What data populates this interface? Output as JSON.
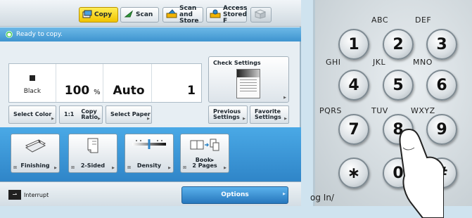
{
  "header": {
    "tabs": [
      {
        "label": "Copy",
        "icon": "copy-icon",
        "active": true
      },
      {
        "label": "Scan",
        "icon": "scan-icon",
        "active": false
      },
      {
        "label": "Scan and\nStore",
        "icon": "scan-store-icon",
        "active": false
      },
      {
        "label": "Access\nStored F",
        "icon": "access-stored-icon",
        "active": false
      }
    ]
  },
  "status": {
    "message": "Ready to copy."
  },
  "settings": {
    "color_mode": "Black",
    "ratio_value": "100",
    "ratio_unit": "%",
    "paper": "Auto",
    "copies": "1"
  },
  "select_buttons": {
    "select_color": "Select Color",
    "ratio_prefix": "1:1",
    "copy_ratio": "Copy\nRatio",
    "select_paper": "Select Paper",
    "previous_settings": "Previous\nSettings",
    "favorite_settings": "Favorite\nSettings"
  },
  "check_settings": {
    "label": "Check Settings"
  },
  "functions": [
    {
      "label": "Finishing",
      "icon": "finishing-icon"
    },
    {
      "label": "2-Sided",
      "icon": "two-sided-icon"
    },
    {
      "label": "Density",
      "icon": "density-icon"
    },
    {
      "label": "Book▸\n2 Pages",
      "icon": "book-to-pages-icon"
    }
  ],
  "bottom": {
    "interrupt": "Interrupt",
    "options": "Options"
  },
  "keypad": {
    "letters": {
      "k2": "ABC",
      "k3": "DEF",
      "k4": "GHI",
      "k5": "JKL",
      "k6": "MNO",
      "k7": "PQRS",
      "k8": "TUV",
      "k9": "WXYZ"
    },
    "keys": [
      "1",
      "2",
      "3",
      "4",
      "5",
      "6",
      "7",
      "8",
      "9",
      "∗",
      "0",
      "#"
    ],
    "login": "og In/"
  },
  "colors": {
    "active_tab": "#f1c400",
    "status_bar": "#3e94cf",
    "function_area": "#2f85c8",
    "options_button": "#2777bd"
  }
}
